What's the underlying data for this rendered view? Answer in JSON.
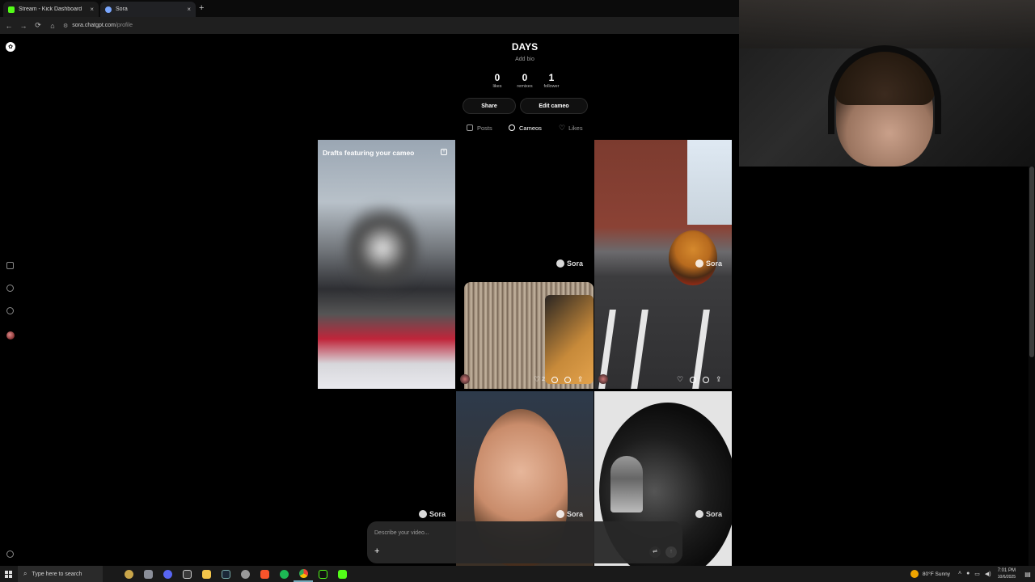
{
  "browser": {
    "tabs": [
      {
        "label": "Stream - Kick Dashboard",
        "favicon_color": "#53fc18",
        "close": "×"
      },
      {
        "label": "Sora",
        "favicon_color": "#7aa7ff",
        "close": "×"
      }
    ],
    "new_tab": "+",
    "nav": {
      "back": "←",
      "forward": "→",
      "reload": "⟳",
      "home": "⌂"
    },
    "address": {
      "host": "sora.chatgpt.com",
      "path": "/profile"
    }
  },
  "profile": {
    "name": "DAYS",
    "bio_placeholder": "Add bio",
    "stats": [
      {
        "value": "0",
        "label": "likes"
      },
      {
        "value": "0",
        "label": "remixes"
      },
      {
        "value": "1",
        "label": "follower"
      }
    ],
    "buttons": {
      "share": "Share",
      "edit_cameo": "Edit cameo"
    },
    "tabs": [
      {
        "label": "Posts",
        "active": false
      },
      {
        "label": "Cameos",
        "active": true
      },
      {
        "label": "Likes",
        "active": false
      }
    ]
  },
  "grid": {
    "drafts_title": "Drafts featuring your cameo",
    "watermark": "Sora",
    "tile2_likes": "2"
  },
  "composer": {
    "placeholder": "Describe your video...",
    "add": "+",
    "send": "↑"
  },
  "taskbar": {
    "search_placeholder": "Type here to search",
    "weather": "80°F  Sunny",
    "time": "7:01 PM",
    "date": "10/6/2025"
  },
  "colors": {
    "background": "#000000",
    "chrome": "#1f1f1f",
    "accent_kick": "#53fc18"
  }
}
